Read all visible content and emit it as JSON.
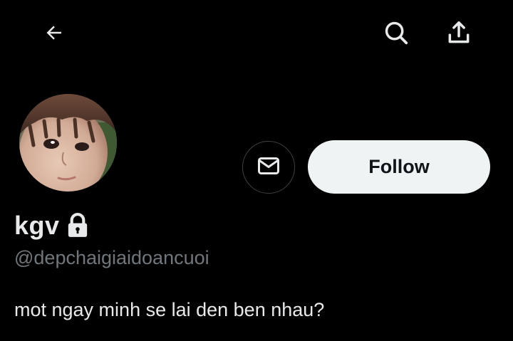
{
  "topbar": {
    "back_icon": "arrow-left-icon",
    "search_icon": "search-icon",
    "share_icon": "share-icon"
  },
  "profile": {
    "display_name": "kgv",
    "handle": "@depchaigiaidoancuoi",
    "bio": "mot ngay minh se lai den ben nhau?",
    "locked_icon": "lock-icon",
    "avatar_icon": "avatar-photo"
  },
  "actions": {
    "message_icon": "envelope-icon",
    "follow_label": "Follow"
  },
  "colors": {
    "background": "#000000",
    "primary_text": "#e7e9ea",
    "secondary_text": "#71767b",
    "follow_bg": "#eff3f4",
    "follow_text": "#0f1419",
    "border": "#3e4144"
  }
}
